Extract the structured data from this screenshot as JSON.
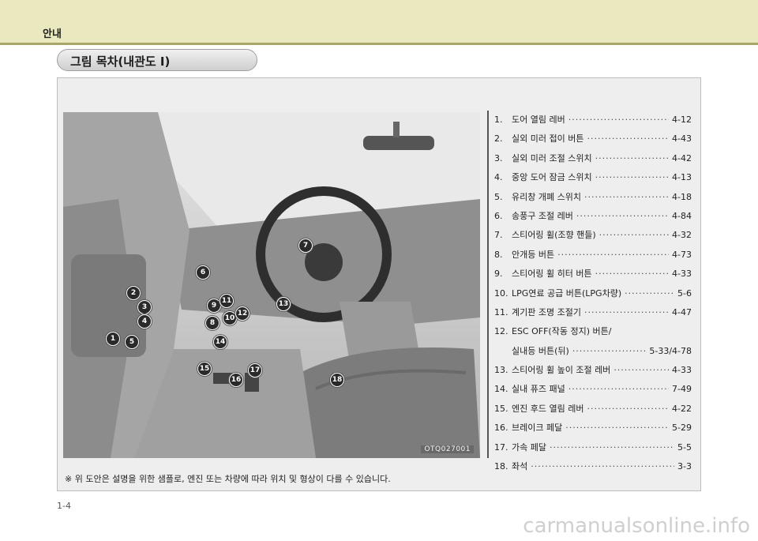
{
  "header": {
    "section_title": "안내"
  },
  "section_heading": "그림 목차(내관도 I)",
  "figure": {
    "code": "OTQ027001",
    "callouts": [
      "1",
      "2",
      "3",
      "4",
      "5",
      "6",
      "7",
      "8",
      "9",
      "10",
      "11",
      "12",
      "13",
      "14",
      "15",
      "16",
      "17",
      "18"
    ]
  },
  "toc": [
    {
      "num": "1.",
      "label": "도어 열림 레버",
      "page": "4-12"
    },
    {
      "num": "2.",
      "label": "실외 미러 접이 버튼",
      "page": "4-43"
    },
    {
      "num": "3.",
      "label": "실외 미러 조절 스위치",
      "page": "4-42"
    },
    {
      "num": "4.",
      "label": "중앙 도어 잠금 스위치",
      "page": "4-13"
    },
    {
      "num": "5.",
      "label": "유리창 개폐 스위치",
      "page": "4-18"
    },
    {
      "num": "6.",
      "label": "송풍구 조절 레버",
      "page": "4-84"
    },
    {
      "num": "7.",
      "label": "스티어링 휠(조향 핸들)",
      "page": "4-32"
    },
    {
      "num": "8.",
      "label": "안개등 버튼",
      "page": "4-73"
    },
    {
      "num": "9.",
      "label": "스티어링 휠 히터 버튼",
      "page": "4-33"
    },
    {
      "num": "10.",
      "label": "LPG연료 공급 버튼(LPG차량)",
      "page": "5-6"
    },
    {
      "num": "11.",
      "label": "계기판 조명 조절기",
      "page": "4-47"
    },
    {
      "num": "12.",
      "label": "ESC OFF(작동 정지) 버튼/",
      "page": ""
    },
    {
      "num": "",
      "label": "실내등 버튼(뒤)",
      "page": "5-33/4-78"
    },
    {
      "num": "13.",
      "label": "스티어링 휠 높이 조절 레버",
      "page": "4-33"
    },
    {
      "num": "14.",
      "label": "실내 퓨즈 패널",
      "page": "7-49"
    },
    {
      "num": "15.",
      "label": "엔진 후드 열림 레버",
      "page": "4-22"
    },
    {
      "num": "16.",
      "label": "브레이크 페달",
      "page": "5-29"
    },
    {
      "num": "17.",
      "label": "가속 페달",
      "page": "5-5"
    },
    {
      "num": "18.",
      "label": "좌석",
      "page": "3-3"
    }
  ],
  "footnote": "※ 위 도안은 설명을 위한 샘플로, 엔진 또는 차량에 따라 위치 및 형상이 다를 수 있습니다.",
  "page_number": "1-4",
  "watermark": "carmanualsonline.info"
}
